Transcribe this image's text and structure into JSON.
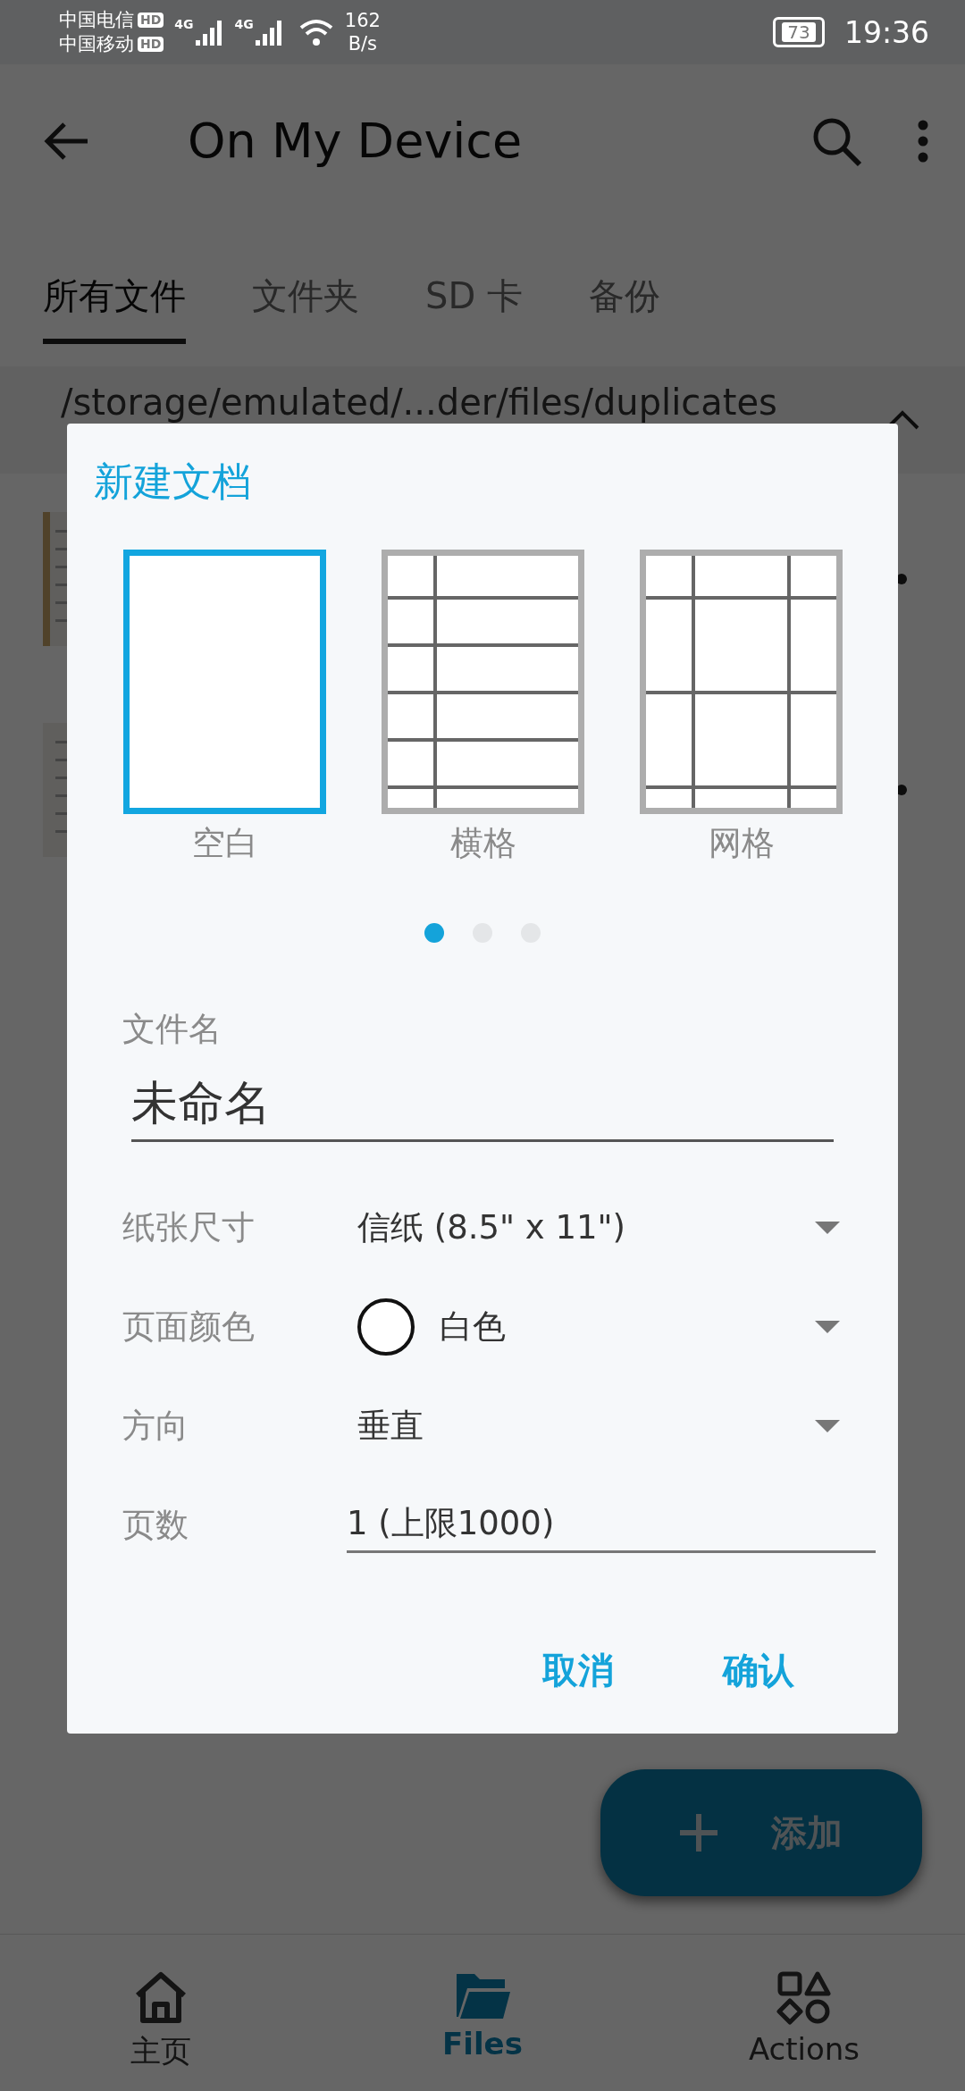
{
  "status_bar": {
    "carriers": [
      {
        "name": "中国电信",
        "badge": "HD"
      },
      {
        "name": "中国移动",
        "badge": "HD"
      }
    ],
    "signals": [
      {
        "label": "4G"
      },
      {
        "label": "4G"
      }
    ],
    "speed": [
      "162",
      "B/s"
    ],
    "battery": "73",
    "time": "19:36"
  },
  "app_bar": {
    "title": "On My Device"
  },
  "tabs": [
    {
      "label": "所有文件",
      "selected": true
    },
    {
      "label": "文件夹",
      "selected": false
    },
    {
      "label": "SD 卡",
      "selected": false
    },
    {
      "label": "备份",
      "selected": false
    }
  ],
  "path": "/storage/emulated/...der/files/duplicates",
  "dialog": {
    "title": "新建文档",
    "templates": [
      {
        "label": "空白",
        "kind": "blank",
        "selected": true
      },
      {
        "label": "横格",
        "kind": "lined",
        "selected": false
      },
      {
        "label": "网格",
        "kind": "grid",
        "selected": false
      }
    ],
    "pager": [
      {
        "selected": true
      },
      {
        "selected": false
      },
      {
        "selected": false
      }
    ],
    "filename": {
      "label": "文件名",
      "value": "未命名"
    },
    "fields": [
      {
        "label": "纸张尺寸",
        "kind": "select",
        "value": "信纸 (8.5\" x 11\")"
      },
      {
        "label": "页面颜色",
        "kind": "color",
        "value": "白色",
        "color": "#ffffff"
      },
      {
        "label": "方向",
        "kind": "select",
        "value": "垂直"
      },
      {
        "label": "页数",
        "kind": "input",
        "value": "1 (上限1000)"
      }
    ],
    "buttons": [
      "取消",
      "确认"
    ]
  },
  "fab": {
    "label": "添加"
  },
  "bottom_nav": [
    {
      "label": "主页",
      "kind": "home",
      "selected": false
    },
    {
      "label": "Files",
      "kind": "folder",
      "selected": true
    },
    {
      "label": "Actions",
      "kind": "shapes",
      "selected": false
    }
  ]
}
